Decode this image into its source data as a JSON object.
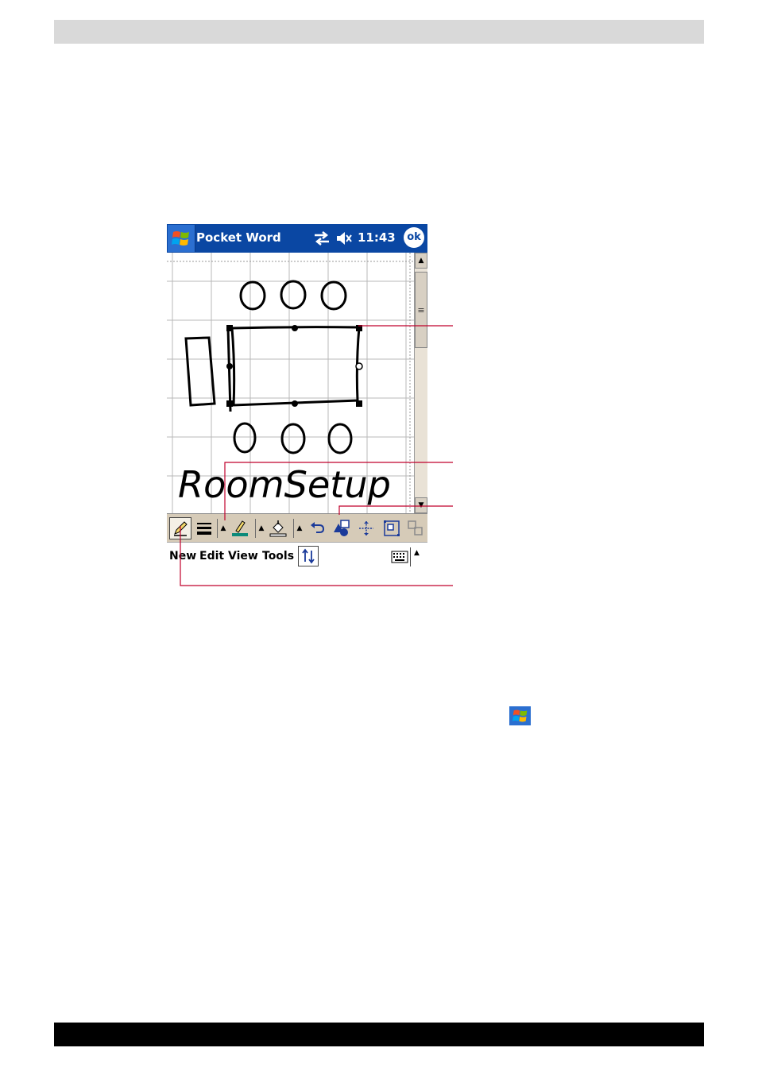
{
  "device": {
    "title": "Pocket Word",
    "time": "11:43",
    "ok_label": "ok"
  },
  "drawing": {
    "handwriting": "RoomSetup"
  },
  "toolbar": {
    "icons": [
      "pen-icon",
      "line-thickness-icon",
      "dropdown-arrow-icon",
      "line-color-icon",
      "dropdown-arrow-icon",
      "fill-color-icon",
      "dropdown-arrow-icon",
      "undo-icon",
      "shapes-icon",
      "align-icon",
      "group-icon",
      "ungroup-icon"
    ]
  },
  "menubar": {
    "items": [
      "New",
      "Edit",
      "View",
      "Tools"
    ]
  },
  "colors": {
    "titlebar": "#0a47a3",
    "toolbar": "#d6cbb8",
    "callout_line": "#c0002c",
    "header_band": "#d9d9d9",
    "footer_band": "#000000"
  }
}
